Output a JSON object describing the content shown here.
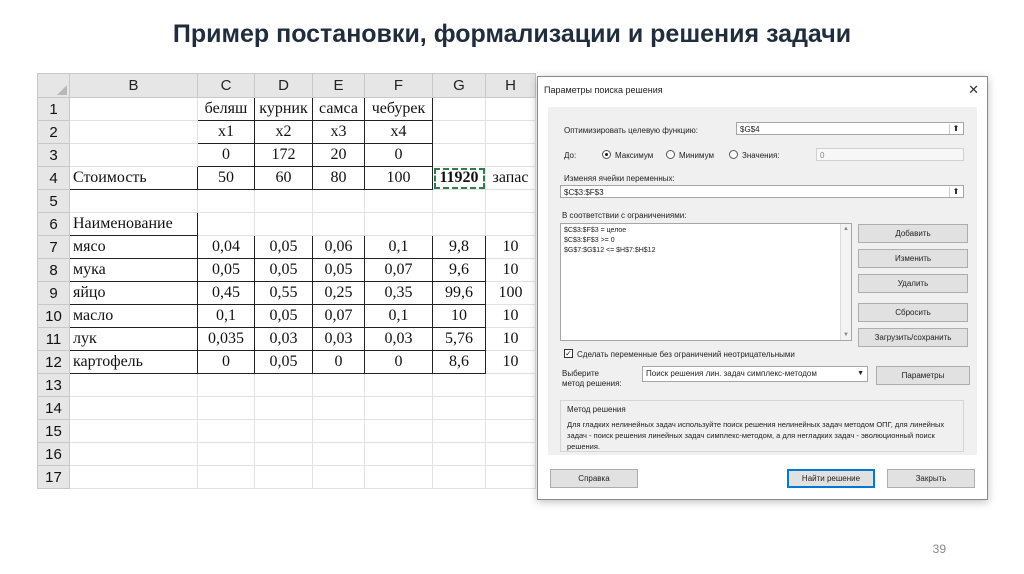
{
  "slide": {
    "title": "Пример постановки, формализации и решения задачи",
    "page_number": "39"
  },
  "sheet": {
    "columns": [
      "B",
      "C",
      "D",
      "E",
      "G",
      "H"
    ],
    "all_columns": [
      "B",
      "C",
      "D",
      "E",
      "F",
      "G",
      "H"
    ],
    "rows": [
      {
        "n": "1",
        "B": "",
        "C": "беляш",
        "D": "курник",
        "E": "самса",
        "F": "чебурек",
        "G": "",
        "H": ""
      },
      {
        "n": "2",
        "B": "",
        "C": "x1",
        "D": "x2",
        "E": "x3",
        "F": "x4",
        "G": "",
        "H": ""
      },
      {
        "n": "3",
        "B": "",
        "C": "0",
        "D": "172",
        "E": "20",
        "F": "0",
        "G": "",
        "H": ""
      },
      {
        "n": "4",
        "B": "Стоимость",
        "C": "50",
        "D": "60",
        "E": "80",
        "F": "100",
        "G": "11920",
        "H": "запас"
      },
      {
        "n": "5",
        "B": "",
        "C": "",
        "D": "",
        "E": "",
        "F": "",
        "G": "",
        "H": ""
      },
      {
        "n": "6",
        "B": "Наименование",
        "C": "",
        "D": "",
        "E": "",
        "F": "",
        "G": "",
        "H": ""
      },
      {
        "n": "7",
        "B": "мясо",
        "C": "0,04",
        "D": "0,05",
        "E": "0,06",
        "F": "0,1",
        "G": "9,8",
        "H": "10"
      },
      {
        "n": "8",
        "B": "мука",
        "C": "0,05",
        "D": "0,05",
        "E": "0,05",
        "F": "0,07",
        "G": "9,6",
        "H": "10"
      },
      {
        "n": "9",
        "B": "яйцо",
        "C": "0,45",
        "D": "0,55",
        "E": "0,25",
        "F": "0,35",
        "G": "99,6",
        "H": "100"
      },
      {
        "n": "10",
        "B": "масло",
        "C": "0,1",
        "D": "0,05",
        "E": "0,07",
        "F": "0,1",
        "G": "10",
        "H": "10"
      },
      {
        "n": "11",
        "B": "лук",
        "C": "0,035",
        "D": "0,03",
        "E": "0,03",
        "F": "0,03",
        "G": "5,76",
        "H": "10"
      },
      {
        "n": "12",
        "B": "картофель",
        "C": "0",
        "D": "0,05",
        "E": "0",
        "F": "0",
        "G": "8,6",
        "H": "10"
      },
      {
        "n": "13",
        "B": "",
        "C": "",
        "D": "",
        "E": "",
        "F": "",
        "G": "",
        "H": ""
      },
      {
        "n": "14",
        "B": "",
        "C": "",
        "D": "",
        "E": "",
        "F": "",
        "G": "",
        "H": ""
      },
      {
        "n": "15",
        "B": "",
        "C": "",
        "D": "",
        "E": "",
        "F": "",
        "G": "",
        "H": ""
      },
      {
        "n": "16",
        "B": "",
        "C": "",
        "D": "",
        "E": "",
        "F": "",
        "G": "",
        "H": ""
      },
      {
        "n": "17",
        "B": "",
        "C": "",
        "D": "",
        "E": "",
        "F": "",
        "G": "",
        "H": ""
      }
    ],
    "highlight_color": "#c0161b"
  },
  "dialog": {
    "title": "Параметры поиска решения",
    "close_glyph": "✕",
    "objective_label": "Оптимизировать целевую функцию:",
    "objective_value": "$G$4",
    "to_label": "До:",
    "radio_max": "Максимум",
    "radio_min": "Минимум",
    "radio_value": "Значения:",
    "value_field": "0",
    "variables_label": "Изменяя ячейки переменных:",
    "variables_value": "$C$3:$F$3",
    "constraints_label": "В соответствии с ограничениями:",
    "constraints": [
      "$C$3:$F$3 = целое",
      "$C$3:$F$3 >= 0",
      "$G$7:$G$12 <= $H$7:$H$12"
    ],
    "btn_add": "Добавить",
    "btn_change": "Изменить",
    "btn_delete": "Удалить",
    "btn_reset": "Сбросить",
    "btn_load_save": "Загрузить/сохранить",
    "checkbox_label": "Сделать переменные без ограничений неотрицательными",
    "method_label_1": "Выберите",
    "method_label_2": "метод решения:",
    "method_value": "Поиск решения лин. задач симплекс-методом",
    "btn_params": "Параметры",
    "method_group_title": "Метод решения",
    "method_description": "Для гладких нелинейных задач используйте поиск решения нелинейных задач методом ОПГ, для линейных задач - поиск решения линейных задач симплекс-методом, а для негладких задач - эволюционный поиск решения.",
    "btn_help": "Справка",
    "btn_solve": "Найти решение",
    "btn_close": "Закрыть",
    "ref_glyph": "⬆"
  }
}
